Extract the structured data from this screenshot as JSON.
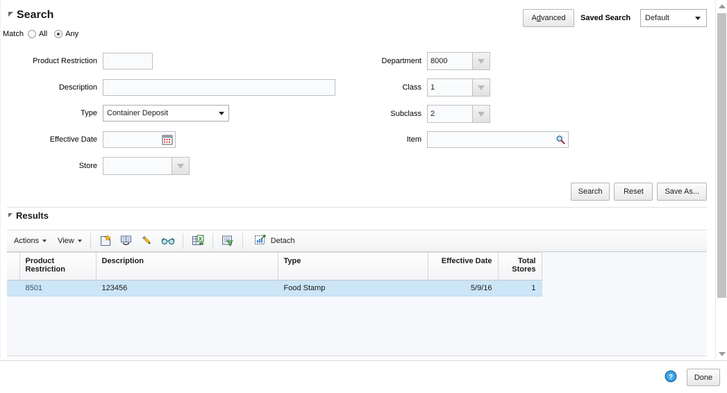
{
  "search_panel": {
    "title": "Search",
    "match_label": "Match",
    "match_options": [
      {
        "label": "All",
        "selected": false
      },
      {
        "label": "Any",
        "selected": true
      }
    ],
    "advanced_button": "Advanced",
    "advanced_accesskey": "d",
    "saved_search_label": "Saved Search",
    "saved_search_value": "Default",
    "fields_left": [
      {
        "label": "Product Restriction",
        "value": "",
        "type": "text"
      },
      {
        "label": "Description",
        "value": "",
        "type": "text"
      },
      {
        "label": "Type",
        "value": "Container Deposit",
        "type": "select"
      },
      {
        "label": "Effective Date",
        "value": "",
        "type": "date"
      },
      {
        "label": "Store",
        "value": "",
        "type": "lov"
      }
    ],
    "fields_right": [
      {
        "label": "Department",
        "value": "8000",
        "type": "lov"
      },
      {
        "label": "Class",
        "value": "1",
        "type": "lov"
      },
      {
        "label": "Subclass",
        "value": "2",
        "type": "lov"
      },
      {
        "label": "Item",
        "value": "",
        "type": "search"
      }
    ],
    "buttons": [
      {
        "label": "Search"
      },
      {
        "label": "Reset"
      },
      {
        "label": "Save As..."
      }
    ]
  },
  "results_panel": {
    "title": "Results",
    "toolbar": {
      "actions_menu": "Actions",
      "view_menu": "View",
      "icons": [
        {
          "name": "create-icon"
        },
        {
          "name": "duplicate-icon"
        },
        {
          "name": "edit-icon"
        },
        {
          "name": "view-glasses-icon"
        },
        {
          "name": "export-to-excel-icon"
        },
        {
          "name": "query-by-example-icon"
        }
      ],
      "detach_label": "Detach"
    },
    "table": {
      "columns": [
        {
          "key": "product_restriction",
          "label": "Product Restriction",
          "align": "left"
        },
        {
          "key": "description",
          "label": "Description",
          "align": "left"
        },
        {
          "key": "type",
          "label": "Type",
          "align": "left"
        },
        {
          "key": "effective_date",
          "label": "Effective Date",
          "align": "right"
        },
        {
          "key": "total_stores",
          "label": "Total Stores",
          "align": "right"
        }
      ],
      "rows": [
        {
          "product_restriction": "8501",
          "description": "123456",
          "type": "Food Stamp",
          "effective_date": "5/9/16",
          "total_stores": "1",
          "selected": true
        }
      ]
    }
  },
  "footer": {
    "help_icon": "help-icon",
    "done_button": "Done"
  },
  "colors": {
    "selected_row": "#cce5f7",
    "link_text": "#36566e",
    "scrollbar_thumb": "#c2c2c2"
  }
}
